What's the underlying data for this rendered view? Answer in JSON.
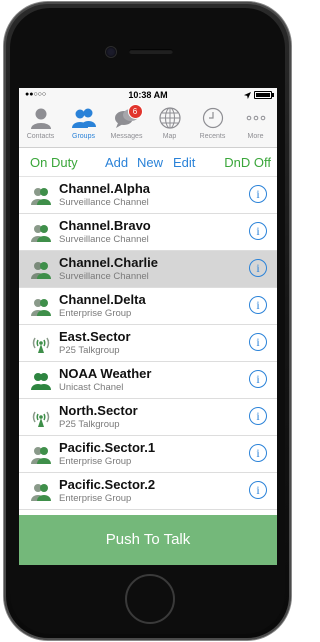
{
  "status_bar": {
    "signal_dots": "●●○○○",
    "time": "10:38 AM"
  },
  "tabs": [
    {
      "label": "Contacts",
      "icon": "person-icon",
      "active": false
    },
    {
      "label": "Groups",
      "icon": "group-icon",
      "active": true
    },
    {
      "label": "Messages",
      "icon": "chat-bubbles-icon",
      "active": false,
      "badge": "6"
    },
    {
      "label": "Map",
      "icon": "globe-icon",
      "active": false
    },
    {
      "label": "Recents",
      "icon": "clock-icon",
      "active": false
    },
    {
      "label": "More",
      "icon": "more-dots-icon",
      "active": false
    }
  ],
  "actions": {
    "on_duty": "On Duty",
    "add": "Add",
    "new": "New",
    "edit": "Edit",
    "dnd": "DnD Off"
  },
  "channels": [
    {
      "name": "Channel.Alpha",
      "type": "Surveillance Channel",
      "icon": "person-group-icon"
    },
    {
      "name": "Channel.Bravo",
      "type": "Surveillance Channel",
      "icon": "person-group-icon"
    },
    {
      "name": "Channel.Charlie",
      "type": "Surveillance Channel",
      "icon": "person-group-icon",
      "selected": true
    },
    {
      "name": "Channel.Delta",
      "type": "Enterprise Group",
      "icon": "person-group-icon"
    },
    {
      "name": "East.Sector",
      "type": "P25 Talkgroup",
      "icon": "radio-antenna-icon"
    },
    {
      "name": "NOAA Weather",
      "type": "Unicast Chanel",
      "icon": "person-group-icon"
    },
    {
      "name": "North.Sector",
      "type": "P25 Talkgroup",
      "icon": "radio-antenna-icon"
    },
    {
      "name": "Pacific.Sector.1",
      "type": "Enterprise Group",
      "icon": "person-group-icon"
    },
    {
      "name": "Pacific.Sector.2",
      "type": "Enterprise Group",
      "icon": "person-group-icon"
    }
  ],
  "info_glyph": "i",
  "push_to_talk": "Push To Talk",
  "colors": {
    "accent_blue": "#2a82d8",
    "green": "#3aa63a",
    "ptt_green": "#74b87a",
    "badge_red": "#e1352d"
  }
}
